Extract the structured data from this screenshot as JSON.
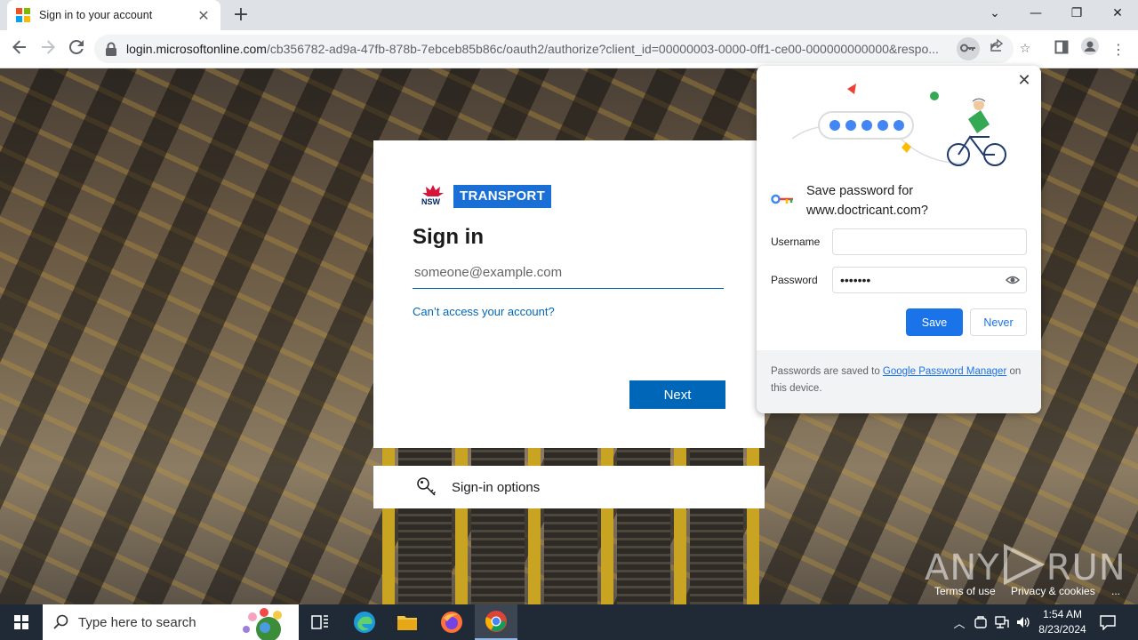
{
  "browser": {
    "tab_title": "Sign in to your account",
    "url_host": "login.microsoftonline.com",
    "url_path": "/cb356782-ad9a-47fb-878b-7ebceb85b86c/oauth2/authorize?client_id=00000003-0000-0ff1-ce00-000000000000&respo..."
  },
  "signin": {
    "logo_nsw_text": "NSW",
    "logo_text": "TRANSPORT",
    "title": "Sign in",
    "email_placeholder": "someone@example.com",
    "cant_access": "Can’t access your account?",
    "next_label": "Next",
    "options_label": "Sign-in options"
  },
  "password_popup": {
    "title_line1": "Save password for",
    "title_line2": "www.doctricant.com?",
    "username_label": "Username",
    "username_value": "",
    "password_label": "Password",
    "password_value": "•••••••",
    "save_label": "Save",
    "never_label": "Never",
    "footer_text_before": "Passwords are saved to ",
    "footer_link": "Google Password Manager",
    "footer_text_after": " on this device."
  },
  "watermark": {
    "brand_left": "ANY",
    "brand_right": "RUN",
    "terms": "Terms of use",
    "privacy": "Privacy & cookies",
    "more": "..."
  },
  "taskbar": {
    "search_placeholder": "Type here to search",
    "time": "1:54 AM",
    "date": "8/23/2024"
  },
  "colors": {
    "ms_blue": "#0067b8",
    "transport_blue": "#1a6fd6",
    "chrome_blue": "#1a73e8"
  }
}
